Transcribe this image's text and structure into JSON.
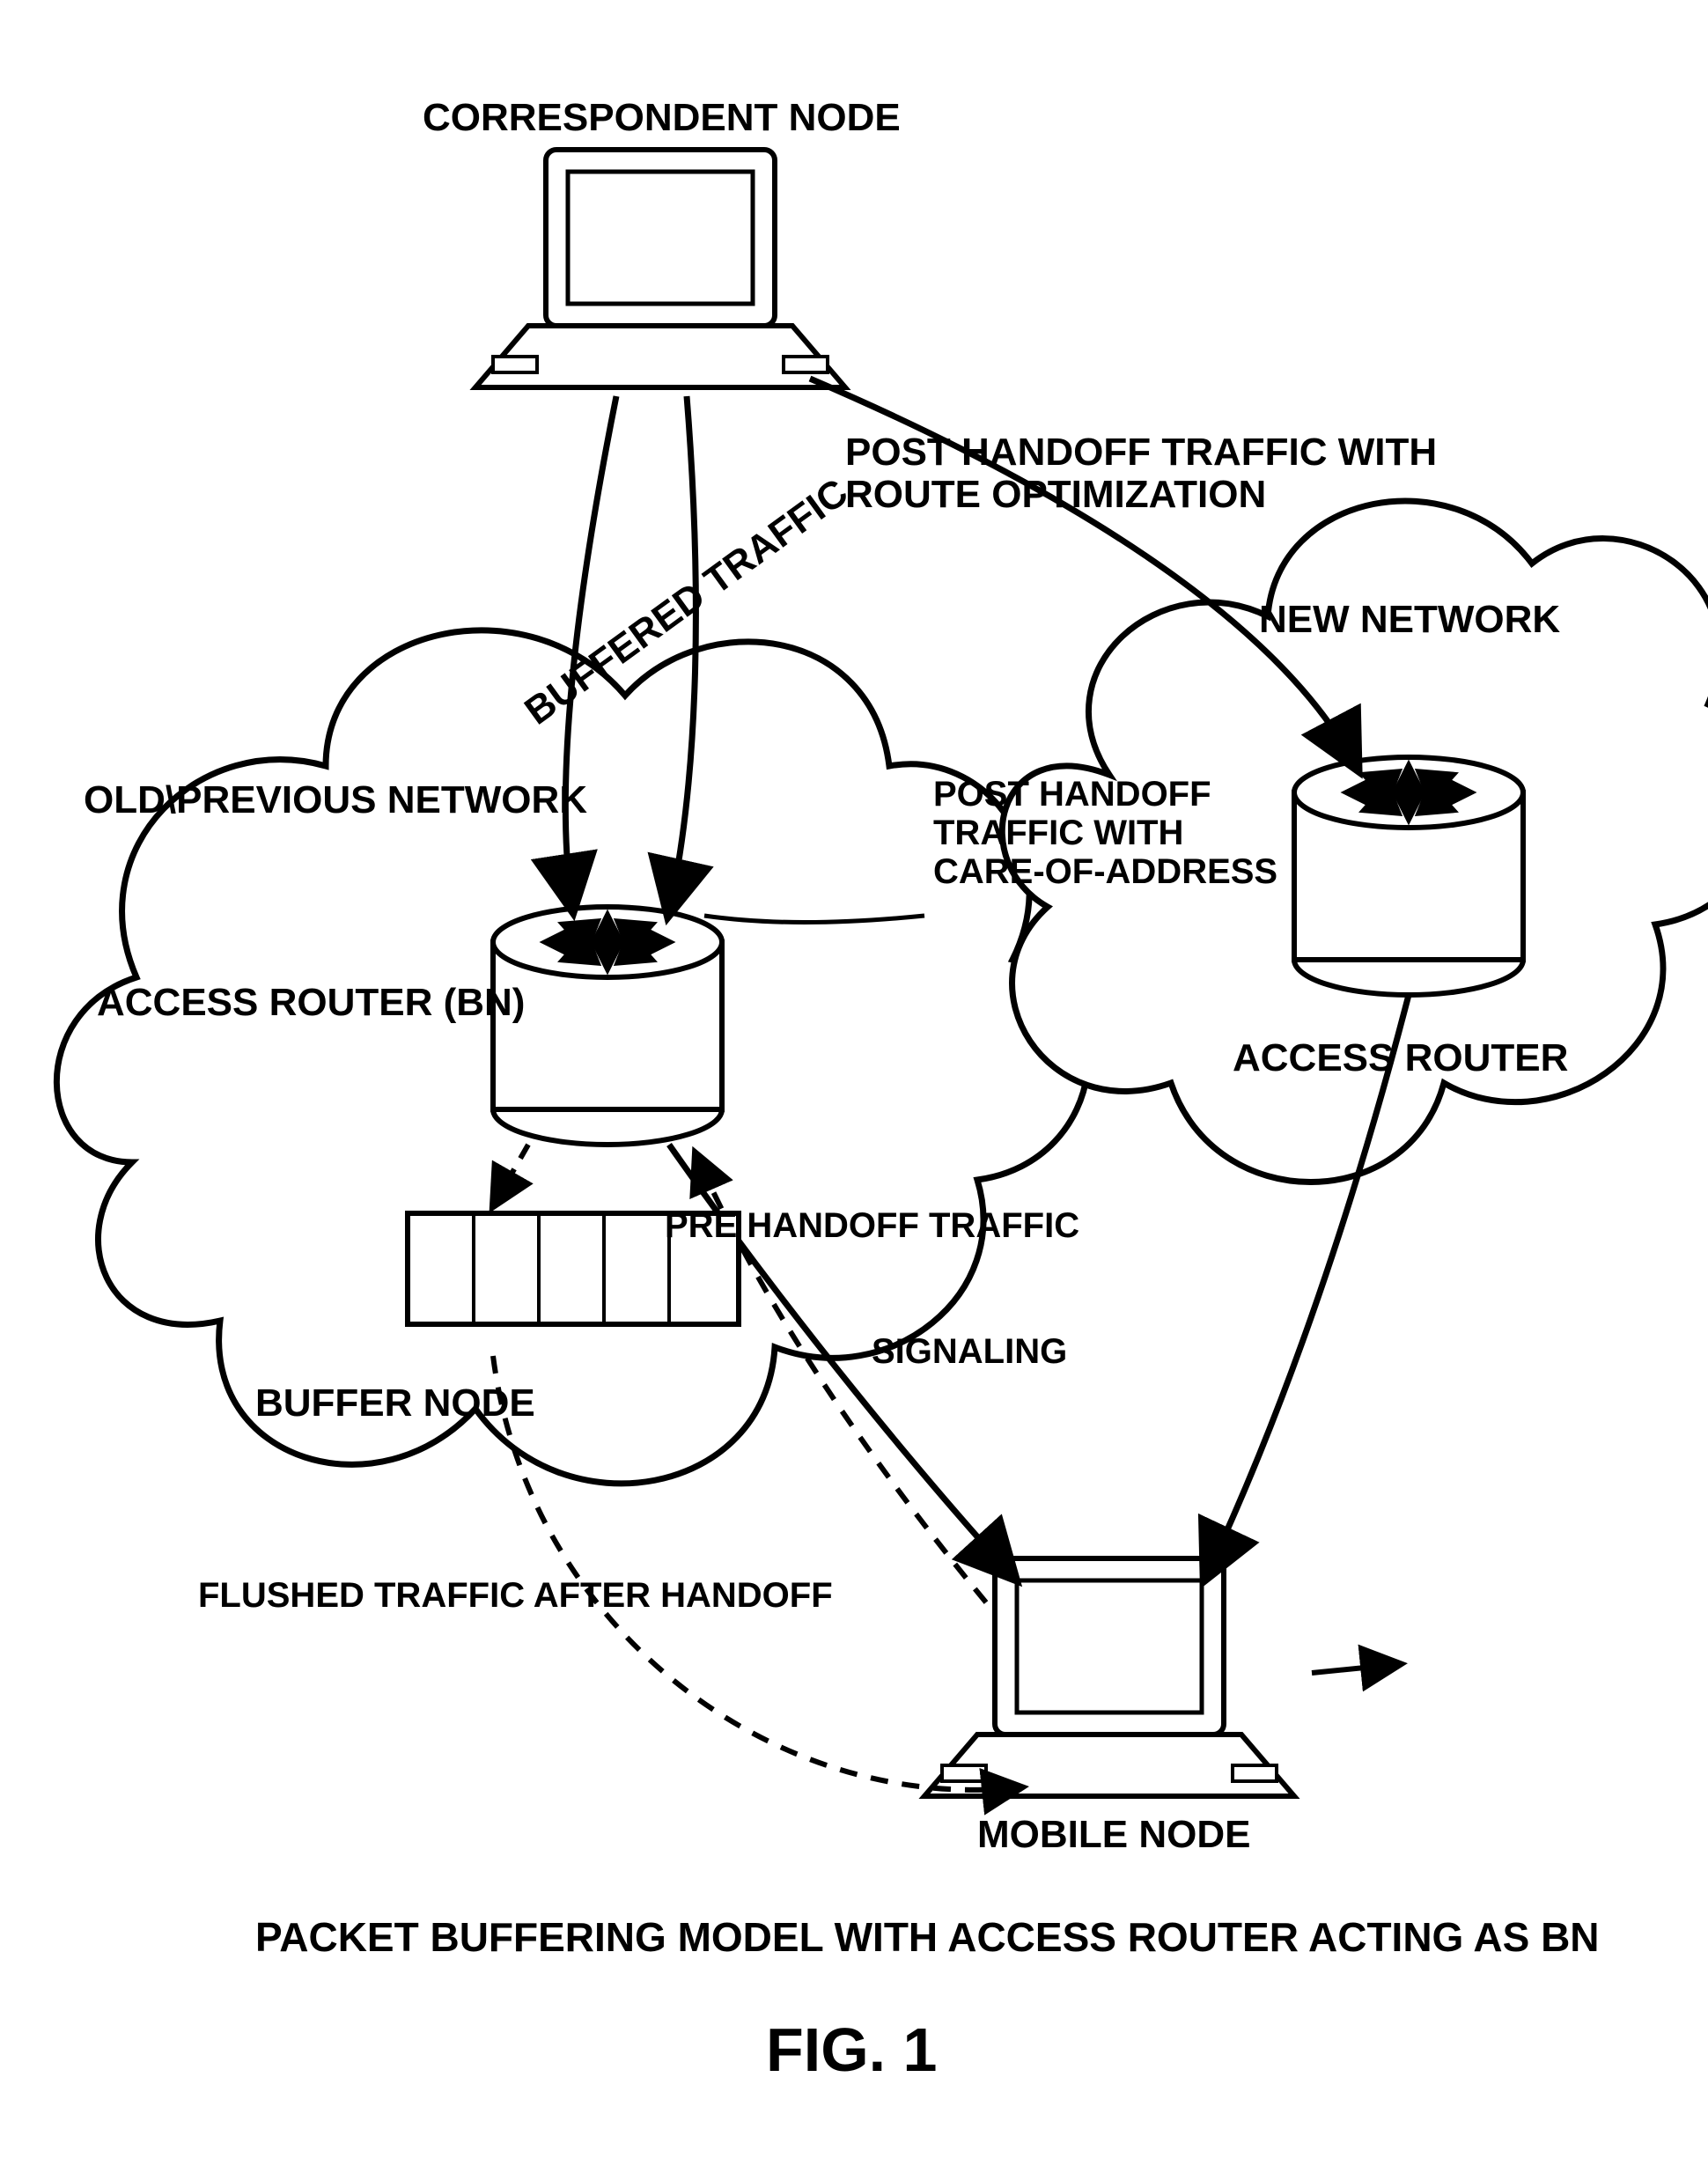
{
  "title": "FIG. 1",
  "caption": "PACKET BUFFERING MODEL WITH ACCESS ROUTER ACTING AS BN",
  "nodes": {
    "correspondent_node": "CORRESPONDENT NODE",
    "mobile_node": "MOBILE NODE"
  },
  "networks": {
    "old": "OLD\\PREVIOUS NETWORK",
    "new": "NEW NETWORK"
  },
  "routers": {
    "old": "ACCESS ROUTER (BN)",
    "new": "ACCESS ROUTER"
  },
  "buffer_node_label": "BUFFER NODE",
  "flows": {
    "buffered_traffic": "BUFFERED TRAFFIC",
    "post_route_opt": "POST HANDOFF TRAFFIC WITH\nROUTE OPTIMIZATION",
    "post_coa": "POST HANDOFF\nTRAFFIC WITH\nCARE-OF-ADDRESS",
    "pre_handoff": "PRE HANDOFF TRAFFIC",
    "signaling": "SIGNALING",
    "flushed": "FLUSHED TRAFFIC AFTER HANDOFF"
  }
}
